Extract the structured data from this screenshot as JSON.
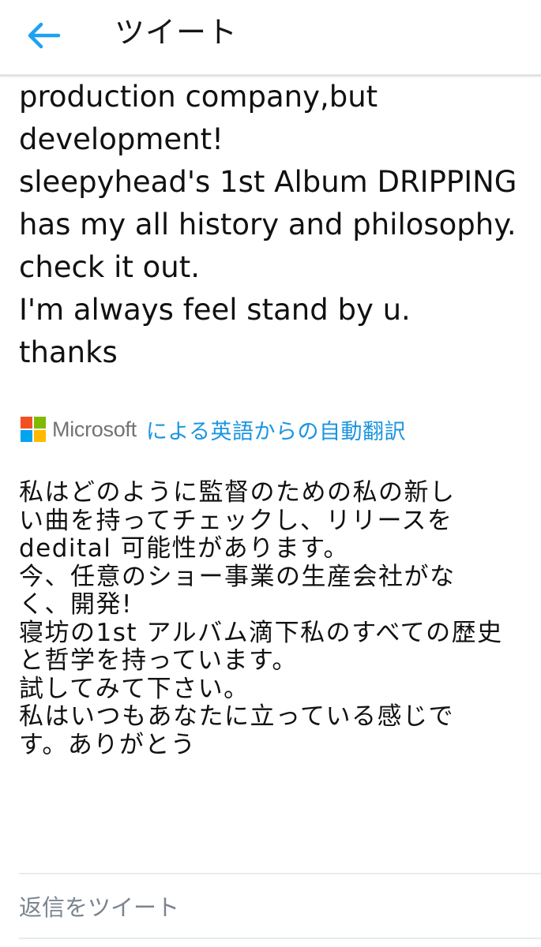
{
  "header": {
    "back_icon": "arrow-left-icon",
    "title": "ツイート",
    "accent_color": "#1da1f2"
  },
  "tweet": {
    "text_lines": [
      "production company,but",
      "development!",
      "sleepyhead's 1st Album DRIPPING",
      "has my all history and philosophy.",
      "check it out.",
      "I'm always feel stand by u.",
      "thanks"
    ]
  },
  "translation": {
    "provider_logo": "microsoft-logo-icon",
    "provider_name": "Microsoft",
    "label": "による英語からの自動翻訳",
    "label_color": "#1b95e0",
    "logo_colors": [
      "#f25022",
      "#7fba00",
      "#00a4ef",
      "#ffb900"
    ],
    "text_lines": [
      "私はどのように監督のための私の新し",
      "い曲を持ってチェックし、リリースを",
      "dedital 可能性があります。",
      "今、任意のショー事業の生産会社がな",
      "く、開発!",
      "寝坊の1st アルバム滴下私のすべての歴史",
      "と哲学を持っています。",
      "試してみて下さい。",
      "私はいつもあなたに立っている感じで",
      "す。ありがとう"
    ]
  },
  "reply": {
    "placeholder": "返信をツイート"
  }
}
